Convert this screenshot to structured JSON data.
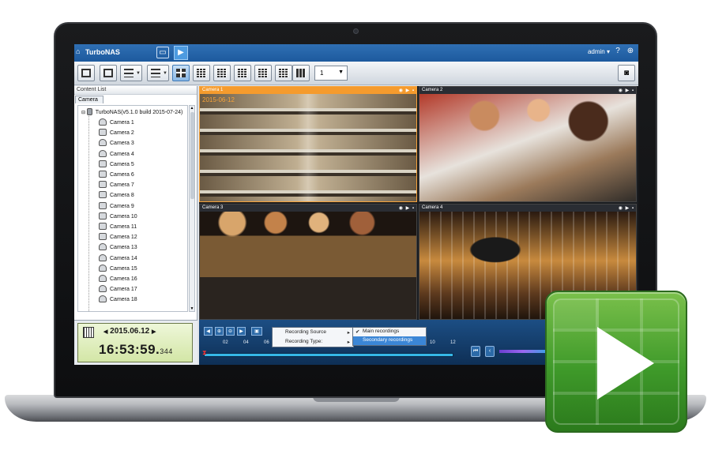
{
  "titlebar": {
    "app_name": "TurboNAS",
    "user": "admin ▾",
    "help": "?",
    "globe": "⊕"
  },
  "toolbar": {
    "page_value": "1"
  },
  "left_panel": {
    "header": "Content List",
    "tab": "Camera",
    "root": "TurboNAS(v5.1.0 build 2015-07-24)",
    "cameras": [
      "Camera 1",
      "Camera 2",
      "Camera 3",
      "Camera 4",
      "Camera 5",
      "Camera 6",
      "Camera 7",
      "Camera 8",
      "Camera 9",
      "Camera 10",
      "Camera 11",
      "Camera 12",
      "Camera 13",
      "Camera 14",
      "Camera 15",
      "Camera 16",
      "Camera 17",
      "Camera 18"
    ]
  },
  "clock": {
    "date": "2015.06.12",
    "time": "16:53:59.",
    "ms": "344",
    "prev": "◀",
    "next": "▶"
  },
  "video": {
    "tiles": [
      {
        "label": "Camera 1",
        "overlay": "2015-06-12"
      },
      {
        "label": "Camera 2"
      },
      {
        "label": "Camera 3"
      },
      {
        "label": "Camera 4"
      }
    ],
    "controls": "◉ ▶ ▪"
  },
  "playback": {
    "ticks": [
      "02",
      "04",
      "06",
      "08",
      "10",
      "12"
    ],
    "menu": {
      "source": "Recording Source",
      "type": "Recording Type:"
    },
    "submenu": {
      "main": "Main recordings",
      "secondary": "Secondary recordings"
    }
  },
  "overlay": {
    "icon": "play-button-icon"
  }
}
